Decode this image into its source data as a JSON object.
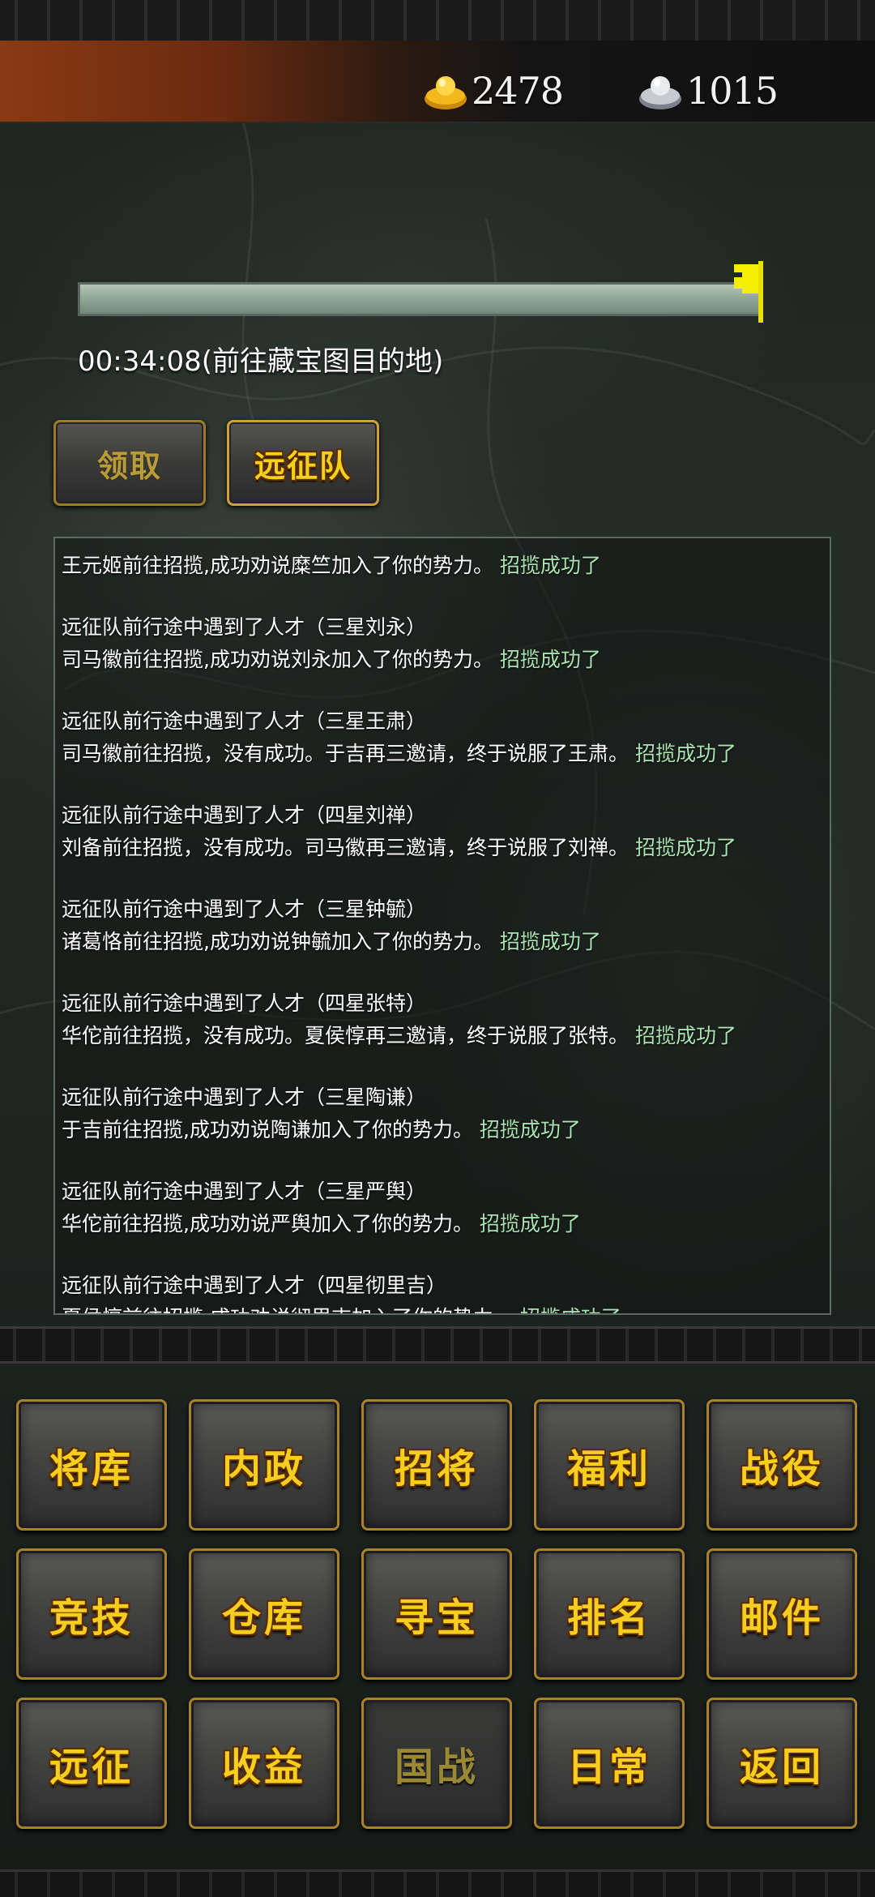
{
  "currency": {
    "gold": "2478",
    "silver": "1015",
    "gold_icon": "gold-ingot-icon",
    "silver_icon": "silver-ingot-icon"
  },
  "expedition": {
    "progress": 1.0,
    "timer_text": "00:34:08(前往藏宝图目的地)",
    "claim_label": "领取",
    "team_label": "远征队"
  },
  "log": [
    {
      "lines": [
        {
          "text": "王元姬前往招揽,成功劝说糜竺加入了你的势力。",
          "status": "招揽成功了"
        }
      ]
    },
    {
      "lines": [
        {
          "text": "远征队前行途中遇到了人才（三星刘永）",
          "status": ""
        },
        {
          "text": "司马徽前往招揽,成功劝说刘永加入了你的势力。",
          "status": "招揽成功了"
        }
      ]
    },
    {
      "lines": [
        {
          "text": "远征队前行途中遇到了人才（三星王肃）",
          "status": ""
        },
        {
          "text": "司马徽前往招揽，没有成功。于吉再三邀请，终于说服了王肃。",
          "status": "招揽成功了"
        }
      ]
    },
    {
      "lines": [
        {
          "text": "远征队前行途中遇到了人才（四星刘禅）",
          "status": ""
        },
        {
          "text": "刘备前往招揽，没有成功。司马徽再三邀请，终于说服了刘禅。",
          "status": "招揽成功了"
        }
      ]
    },
    {
      "lines": [
        {
          "text": "远征队前行途中遇到了人才（三星钟毓）",
          "status": ""
        },
        {
          "text": "诸葛恪前往招揽,成功劝说钟毓加入了你的势力。",
          "status": "招揽成功了"
        }
      ]
    },
    {
      "lines": [
        {
          "text": "远征队前行途中遇到了人才（四星张特）",
          "status": ""
        },
        {
          "text": "华佗前往招揽，没有成功。夏侯惇再三邀请，终于说服了张特。",
          "status": "招揽成功了"
        }
      ]
    },
    {
      "lines": [
        {
          "text": "远征队前行途中遇到了人才（三星陶谦）",
          "status": ""
        },
        {
          "text": "于吉前往招揽,成功劝说陶谦加入了你的势力。",
          "status": "招揽成功了"
        }
      ]
    },
    {
      "lines": [
        {
          "text": "远征队前行途中遇到了人才（三星严舆）",
          "status": ""
        },
        {
          "text": "华佗前往招揽,成功劝说严舆加入了你的势力。",
          "status": "招揽成功了"
        }
      ]
    },
    {
      "lines": [
        {
          "text": "远征队前行途中遇到了人才（四星彻里吉）",
          "status": ""
        },
        {
          "text": "夏侯惇前往招揽,成功劝说彻里吉加入了你的势力。",
          "status": "招揽成功了"
        }
      ]
    }
  ],
  "menu": [
    {
      "label": "将库",
      "name": "menu-generals-button",
      "dim": false
    },
    {
      "label": "内政",
      "name": "menu-internal-affairs-button",
      "dim": false
    },
    {
      "label": "招将",
      "name": "menu-recruit-button",
      "dim": false
    },
    {
      "label": "福利",
      "name": "menu-welfare-button",
      "dim": false
    },
    {
      "label": "战役",
      "name": "menu-campaign-button",
      "dim": false
    },
    {
      "label": "竞技",
      "name": "menu-arena-button",
      "dim": false
    },
    {
      "label": "仓库",
      "name": "menu-warehouse-button",
      "dim": false
    },
    {
      "label": "寻宝",
      "name": "menu-treasure-hunt-button",
      "dim": false
    },
    {
      "label": "排名",
      "name": "menu-ranking-button",
      "dim": false
    },
    {
      "label": "邮件",
      "name": "menu-mail-button",
      "dim": false
    },
    {
      "label": "远征",
      "name": "menu-expedition-button",
      "dim": false
    },
    {
      "label": "收益",
      "name": "menu-income-button",
      "dim": false
    },
    {
      "label": "国战",
      "name": "menu-nation-war-button",
      "dim": true
    },
    {
      "label": "日常",
      "name": "menu-daily-button",
      "dim": false
    },
    {
      "label": "返回",
      "name": "menu-back-button",
      "dim": false
    }
  ],
  "colors": {
    "accent_gold": "#f6cf1e",
    "success_text": "#a9e3b0",
    "header_orange": "#8a3a12"
  }
}
